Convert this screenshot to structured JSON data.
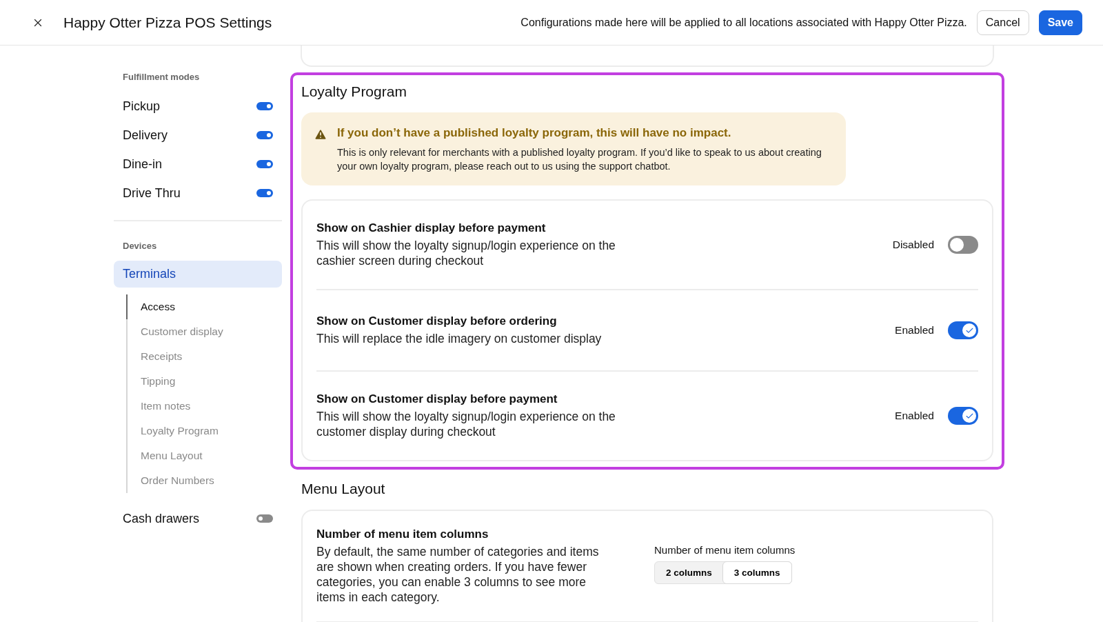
{
  "header": {
    "title": "Happy Otter Pizza POS Settings",
    "notice": "Configurations made here will be applied to all locations associated with Happy Otter Pizza.",
    "buttons": [
      {
        "label": "Cancel",
        "kind": "secondary"
      },
      {
        "label": "Save",
        "kind": "primary"
      }
    ]
  },
  "sidebar": {
    "sections": [
      {
        "heading": "Fulfillment modes",
        "items": [
          {
            "label": "Pickup",
            "kind": "toggle",
            "on": true
          },
          {
            "label": "Delivery",
            "kind": "toggle",
            "on": true
          },
          {
            "label": "Dine-in",
            "kind": "toggle",
            "on": true
          },
          {
            "label": "Drive Thru",
            "kind": "toggle",
            "on": true
          }
        ]
      },
      {
        "heading": "Devices",
        "items": [
          {
            "label": "Terminals",
            "kind": "nav",
            "selected": true,
            "children": [
              {
                "label": "Access",
                "selected": true
              },
              {
                "label": "Customer display",
                "selected": false
              },
              {
                "label": "Receipts",
                "selected": false
              },
              {
                "label": "Tipping",
                "selected": false
              },
              {
                "label": "Item notes",
                "selected": false
              },
              {
                "label": "Loyalty Program",
                "selected": false
              },
              {
                "label": "Menu Layout",
                "selected": false
              },
              {
                "label": "Order Numbers",
                "selected": false
              }
            ]
          },
          {
            "label": "Cash drawers",
            "kind": "toggle",
            "on": false
          }
        ]
      }
    ]
  },
  "loyalty": {
    "title": "Loyalty Program",
    "highlighted": true,
    "notice": {
      "heading": "If you don’t have a published loyalty program, this will have no impact.",
      "body": "This is only relevant for merchants with a published loyalty program. If you’d like to speak to us about creating your own loyalty program, please reach out to us using the support chatbot."
    },
    "settings": [
      {
        "title": "Show on Cashier display before payment",
        "description": "This will show the loyalty signup/login experience on the cashier screen during checkout",
        "status": "Disabled",
        "on": false
      },
      {
        "title": "Show on Customer display before ordering",
        "description": "This will replace the idle imagery on customer display",
        "status": "Enabled",
        "on": true
      },
      {
        "title": "Show on Customer display before payment",
        "description": "This will show the loyalty signup/login experience on the customer display during checkout",
        "status": "Enabled",
        "on": true
      }
    ]
  },
  "menu_layout": {
    "title": "Menu Layout",
    "settings": [
      {
        "title": "Number of menu item columns",
        "description": "By default, the same number of categories and items are shown when creating orders. If you have fewer categories, you can enable 3 columns to see more items in each category.",
        "control_label": "Number of menu item columns",
        "options": [
          {
            "label": "2 columns",
            "selected": false
          },
          {
            "label": "3 columns",
            "selected": true
          }
        ]
      }
    ]
  }
}
